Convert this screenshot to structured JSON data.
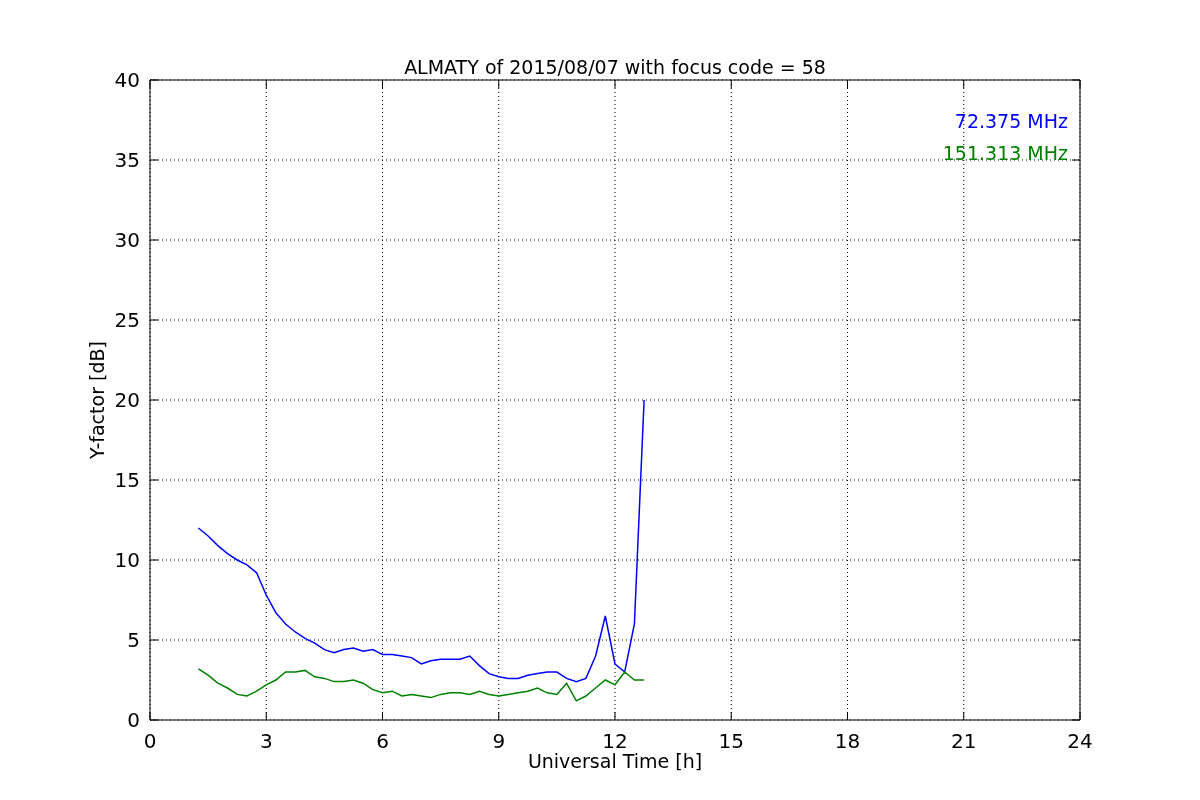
{
  "figure": {
    "chart_data": {
      "type": "line",
      "title": "ALMATY of 2015/08/07 with focus code = 58",
      "xlabel": "Universal Time [h]",
      "ylabel": "Y-factor [dB]",
      "x": [
        1.25,
        1.5,
        1.75,
        2,
        2.25,
        2.5,
        2.75,
        3,
        3.25,
        3.5,
        3.75,
        4,
        4.25,
        4.5,
        4.75,
        5,
        5.25,
        5.5,
        5.75,
        6,
        6.25,
        6.5,
        6.75,
        7,
        7.25,
        7.5,
        7.75,
        8,
        8.25,
        8.5,
        8.75,
        9,
        9.25,
        9.5,
        9.75,
        10,
        10.25,
        10.5,
        10.75,
        11,
        11.25,
        11.5,
        11.75,
        12,
        12.25,
        12.5,
        12.75
      ],
      "series": [
        {
          "name": "72.375 MHz",
          "color": "#0000ff",
          "values": [
            12,
            11.5,
            10.9,
            10.4,
            10,
            9.7,
            9.2,
            7.8,
            6.7,
            6,
            5.5,
            5.1,
            4.8,
            4.4,
            4.2,
            4.4,
            4.5,
            4.3,
            4.4,
            4.1,
            4.1,
            4,
            3.9,
            3.5,
            3.7,
            3.8,
            3.8,
            3.8,
            4,
            3.4,
            2.9,
            2.7,
            2.6,
            2.6,
            2.8,
            2.9,
            3,
            3,
            2.6,
            2.4,
            2.6,
            4,
            6.5,
            3.5,
            3,
            6,
            20
          ]
        },
        {
          "name": "151.313 MHz",
          "color": "#008000",
          "values": [
            3.2,
            2.8,
            2.3,
            2,
            1.6,
            1.5,
            1.8,
            2.2,
            2.5,
            3,
            3,
            3.1,
            2.7,
            2.6,
            2.4,
            2.4,
            2.5,
            2.3,
            1.9,
            1.7,
            1.8,
            1.5,
            1.6,
            1.5,
            1.4,
            1.6,
            1.7,
            1.7,
            1.6,
            1.8,
            1.6,
            1.5,
            1.6,
            1.7,
            1.8,
            2,
            1.7,
            1.6,
            2.3,
            1.2,
            1.5,
            2,
            2.5,
            2.2,
            3,
            2.5,
            2.5
          ]
        }
      ],
      "grid": true,
      "xlim": [
        0,
        24
      ],
      "ylim": [
        0,
        40
      ],
      "xticks": [
        0,
        3,
        6,
        9,
        12,
        15,
        18,
        21,
        24
      ],
      "yticks": [
        0,
        5,
        10,
        15,
        20,
        25,
        30,
        35,
        40
      ]
    }
  }
}
